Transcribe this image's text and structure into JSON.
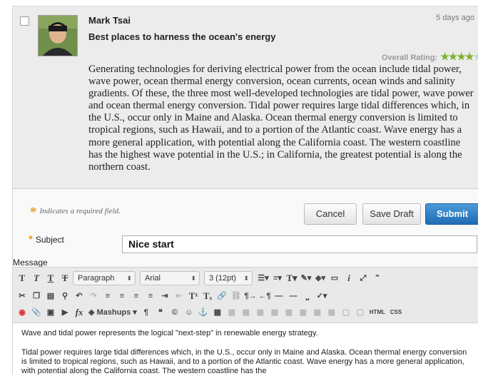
{
  "post": {
    "author": "Mark Tsai",
    "age": "5 days ago",
    "title": "Best places to harness the ocean's energy",
    "rating_label": "Overall Rating:",
    "rating_value": 4,
    "rating_max": 5,
    "body": "Generating technologies for deriving electrical power from the ocean include tidal power, wave power, ocean thermal energy conversion, ocean currents, ocean winds and salinity gradients. Of these, the three most well-developed technologies are tidal power, wave power and ocean thermal energy conversion. Tidal power requires large tidal differences which, in the U.S., occur only in Maine and Alaska. Ocean thermal energy conversion is limited to tropical regions, such as Hawaii, and to a portion of the Atlantic coast. Wave energy has a more general application, with potential along the California coast. The western coastline has the highest wave potential in the U.S.; in California, the greatest potential is along the northern coast."
  },
  "editor": {
    "required_note": "Indicates a required field.",
    "cancel_label": "Cancel",
    "save_draft_label": "Save Draft",
    "submit_label": "Submit",
    "subject_label": "Subject",
    "subject_value": "Nice start",
    "message_label": "Message",
    "paragraph_select": "Paragraph",
    "font_select": "Arial",
    "size_select": "3 (12pt)",
    "mashups_label": "Mashups",
    "html_label": "HTML",
    "css_label": "CSS",
    "content_p1": "Wave and tidal power represents the logical \"next-step\" in renewable energy strategy.",
    "content_p2": "Tidal power requires large tidal differences which, in the U.S., occur only in Maine and Alaska. Ocean thermal energy conversion is limited to tropical regions, such as Hawaii, and to a portion of the Atlantic coast. Wave energy has a more general application, with potential along the California coast. The western coastline has the"
  },
  "colors": {
    "accent_orange": "#f39c12",
    "star_green": "#7fb22f",
    "submit_blue": "#2a7bc4"
  }
}
